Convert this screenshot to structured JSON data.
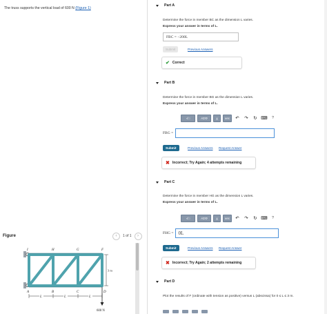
{
  "problem": {
    "text": "The truss supports the vertical load of 600 N",
    "figure_link": "(Figure 1)"
  },
  "figure": {
    "title": "Figure",
    "pager": "1 of 1",
    "prev_icon": "chevron-left-icon",
    "next_icon": "chevron-right-icon",
    "labels": {
      "I": "I",
      "H": "H",
      "G": "G",
      "F": "F",
      "A": "A",
      "B": "B",
      "C": "C",
      "D": "D",
      "L1": "L",
      "L2": "L",
      "L3": "L",
      "height": "3 m",
      "load": "600 N"
    },
    "colors": {
      "member": "#4fa3ad",
      "member_dark": "#2f6e78",
      "support": "#9aa3aa"
    }
  },
  "partA": {
    "title": "Part A",
    "question": "Determine the force in member BC as the dimension L varies.",
    "instruction": "Express your answer in terms of L.",
    "answer": "FBC = −200L",
    "submit": "Submit",
    "previous": "Previous Answers",
    "feedback": "Correct"
  },
  "partB": {
    "title": "Part B",
    "question": "Determine the force in member BG as the dimension L varies.",
    "instruction": "Express your answer in terms of L.",
    "toolbar": {
      "templates": "√□",
      "symbols": "ΑΣΦ",
      "vector": "vec",
      "undo_icon": "↶",
      "redo_icon": "↷",
      "reset_icon": "↻",
      "keyboard_icon": "⌨",
      "help": "?"
    },
    "label": "FBG =",
    "input_value": "",
    "submit": "Submit",
    "previous": "Previous Answers",
    "request": "Request Answer",
    "feedback": "Incorrect; Try Again; 4 attempts remaining"
  },
  "partC": {
    "title": "Part C",
    "question": "Determine the force in member HG as the dimension L varies.",
    "instruction": "Express your answer in terms of L.",
    "toolbar": {
      "templates": "√□",
      "symbols": "ΑΣΦ",
      "vector": "vec",
      "undo_icon": "↶",
      "redo_icon": "↷",
      "reset_icon": "↻",
      "keyboard_icon": "⌨",
      "help": "?"
    },
    "label": "FHG =",
    "input_value": "0L",
    "submit": "Submit",
    "previous": "Previous Answers",
    "request": "Request Answer",
    "feedback": "Incorrect; Try Again; 2 attempts remaining"
  },
  "partD": {
    "title": "Part D",
    "question": "Plot the results of F (ordinate with tension as positive) versus L (abscissa) for 0 ≤ L ≤ 3 m."
  }
}
